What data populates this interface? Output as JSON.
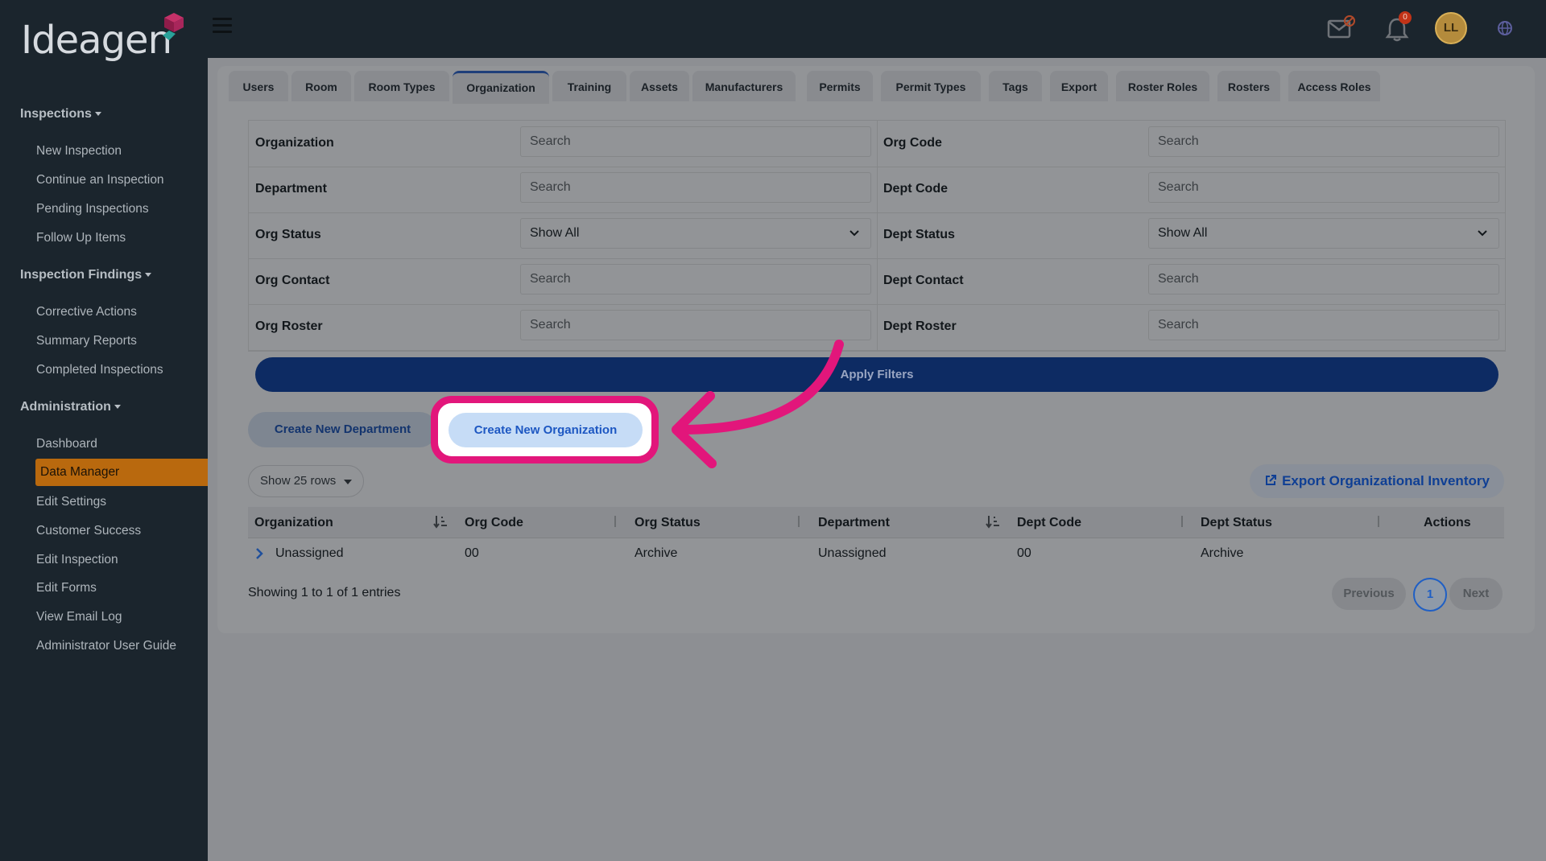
{
  "brand": {
    "name": "Ideagen"
  },
  "topbar": {
    "notification_count": "0",
    "user_initials": "LL"
  },
  "sidebar": {
    "sections": [
      {
        "label": "Inspections",
        "items": [
          "New Inspection",
          "Continue an Inspection",
          "Pending Inspections",
          "Follow Up Items"
        ]
      },
      {
        "label": "Inspection Findings",
        "items": [
          "Corrective Actions",
          "Summary Reports",
          "Completed Inspections"
        ]
      },
      {
        "label": "Administration",
        "items": [
          "Dashboard",
          "Data Manager",
          "Edit Settings",
          "Customer Success",
          "Edit Inspection",
          "Edit Forms",
          "View Email Log",
          "Administrator User Guide"
        ]
      }
    ],
    "active_item": "Data Manager"
  },
  "tabs": [
    "Users",
    "Room",
    "Room Types",
    "Organization",
    "Training",
    "Assets",
    "Manufacturers",
    "Permits",
    "Permit Types",
    "Tags",
    "Export",
    "Roster Roles",
    "Rosters",
    "Access Roles"
  ],
  "active_tab": "Organization",
  "filters": {
    "organization": {
      "label": "Organization",
      "placeholder": "Search"
    },
    "org_code": {
      "label": "Org Code",
      "placeholder": "Search"
    },
    "department": {
      "label": "Department",
      "placeholder": "Search"
    },
    "dept_code": {
      "label": "Dept Code",
      "placeholder": "Search"
    },
    "org_status": {
      "label": "Org Status",
      "value": "Show All"
    },
    "dept_status": {
      "label": "Dept Status",
      "value": "Show All"
    },
    "org_contact": {
      "label": "Org Contact",
      "placeholder": "Search"
    },
    "dept_contact": {
      "label": "Dept Contact",
      "placeholder": "Search"
    },
    "org_roster": {
      "label": "Org Roster",
      "placeholder": "Search"
    },
    "dept_roster": {
      "label": "Dept Roster",
      "placeholder": "Search"
    },
    "apply_label": "Apply Filters"
  },
  "actions": {
    "create_department": "Create New Department",
    "create_organization": "Create New Organization",
    "rows_per_page": "Show 25 rows",
    "export_label": "Export Organizational Inventory"
  },
  "table": {
    "columns": [
      "Organization",
      "Org Code",
      "Org Status",
      "Department",
      "Dept Code",
      "Dept Status",
      "Actions"
    ],
    "rows": [
      {
        "organization": "Unassigned",
        "org_code": "00",
        "org_status": "Archive",
        "department": "Unassigned",
        "dept_code": "00",
        "dept_status": "Archive"
      }
    ],
    "footer": "Showing 1 to 1 of 1 entries"
  },
  "pagination": {
    "previous": "Previous",
    "current": "1",
    "next": "Next"
  },
  "colors": {
    "highlight": "#e2167b",
    "sidebar_bg": "#1b252d",
    "active_nav": "#b9690e",
    "primary": "#0d2b63"
  },
  "icons": [
    "menu-icon",
    "mail-icon",
    "bell-icon",
    "globe-icon",
    "chevron-down-icon",
    "sort-icon",
    "external-link-icon",
    "chevron-right-icon",
    "arrow-icon"
  ]
}
